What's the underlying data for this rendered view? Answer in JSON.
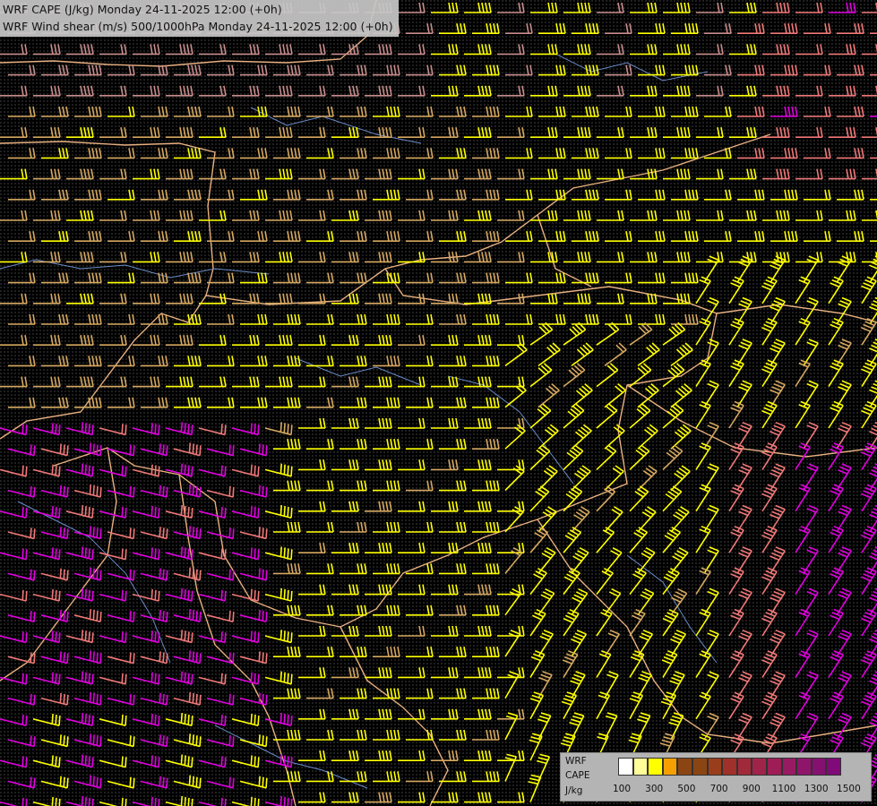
{
  "title": {
    "line1": "WRF CAPE (J/kg) Monday 24-11-2025 12:00 (+0h)",
    "line2": "WRF Wind shear (m/s) 500/1000hPa Monday 24-11-2025 12:00 (+0h)"
  },
  "legend": {
    "model": "WRF",
    "variable": "CAPE",
    "units": "J/kg",
    "tick_labels": [
      "100",
      "300",
      "500",
      "700",
      "900",
      "1100",
      "1300",
      "1500"
    ],
    "colors": [
      "#ffffff",
      "#ffff99",
      "#ffff00",
      "#f5a000",
      "#8b4513",
      "#8b4513",
      "#9a3d1b",
      "#a0302a",
      "#a02a3a",
      "#a0244a",
      "#9e1d56",
      "#981a62",
      "#8f156a",
      "#861070",
      "#800a78"
    ]
  },
  "map": {
    "background_color": "#000000",
    "barb_colors": {
      "low": "#ffff00",
      "mid": "#d6a860",
      "upper_mid": "#c88c8c",
      "high": "#f07878",
      "very_high": "#e000e0"
    },
    "border_color": "#e8b080",
    "coast_color": "#6a8cc8",
    "barb_color_zones": [
      {
        "region": "north",
        "color": "mid"
      },
      {
        "region": "central",
        "color": "low"
      },
      {
        "region": "southwest",
        "color": "very_high"
      },
      {
        "region": "east",
        "color": "high"
      }
    ]
  }
}
